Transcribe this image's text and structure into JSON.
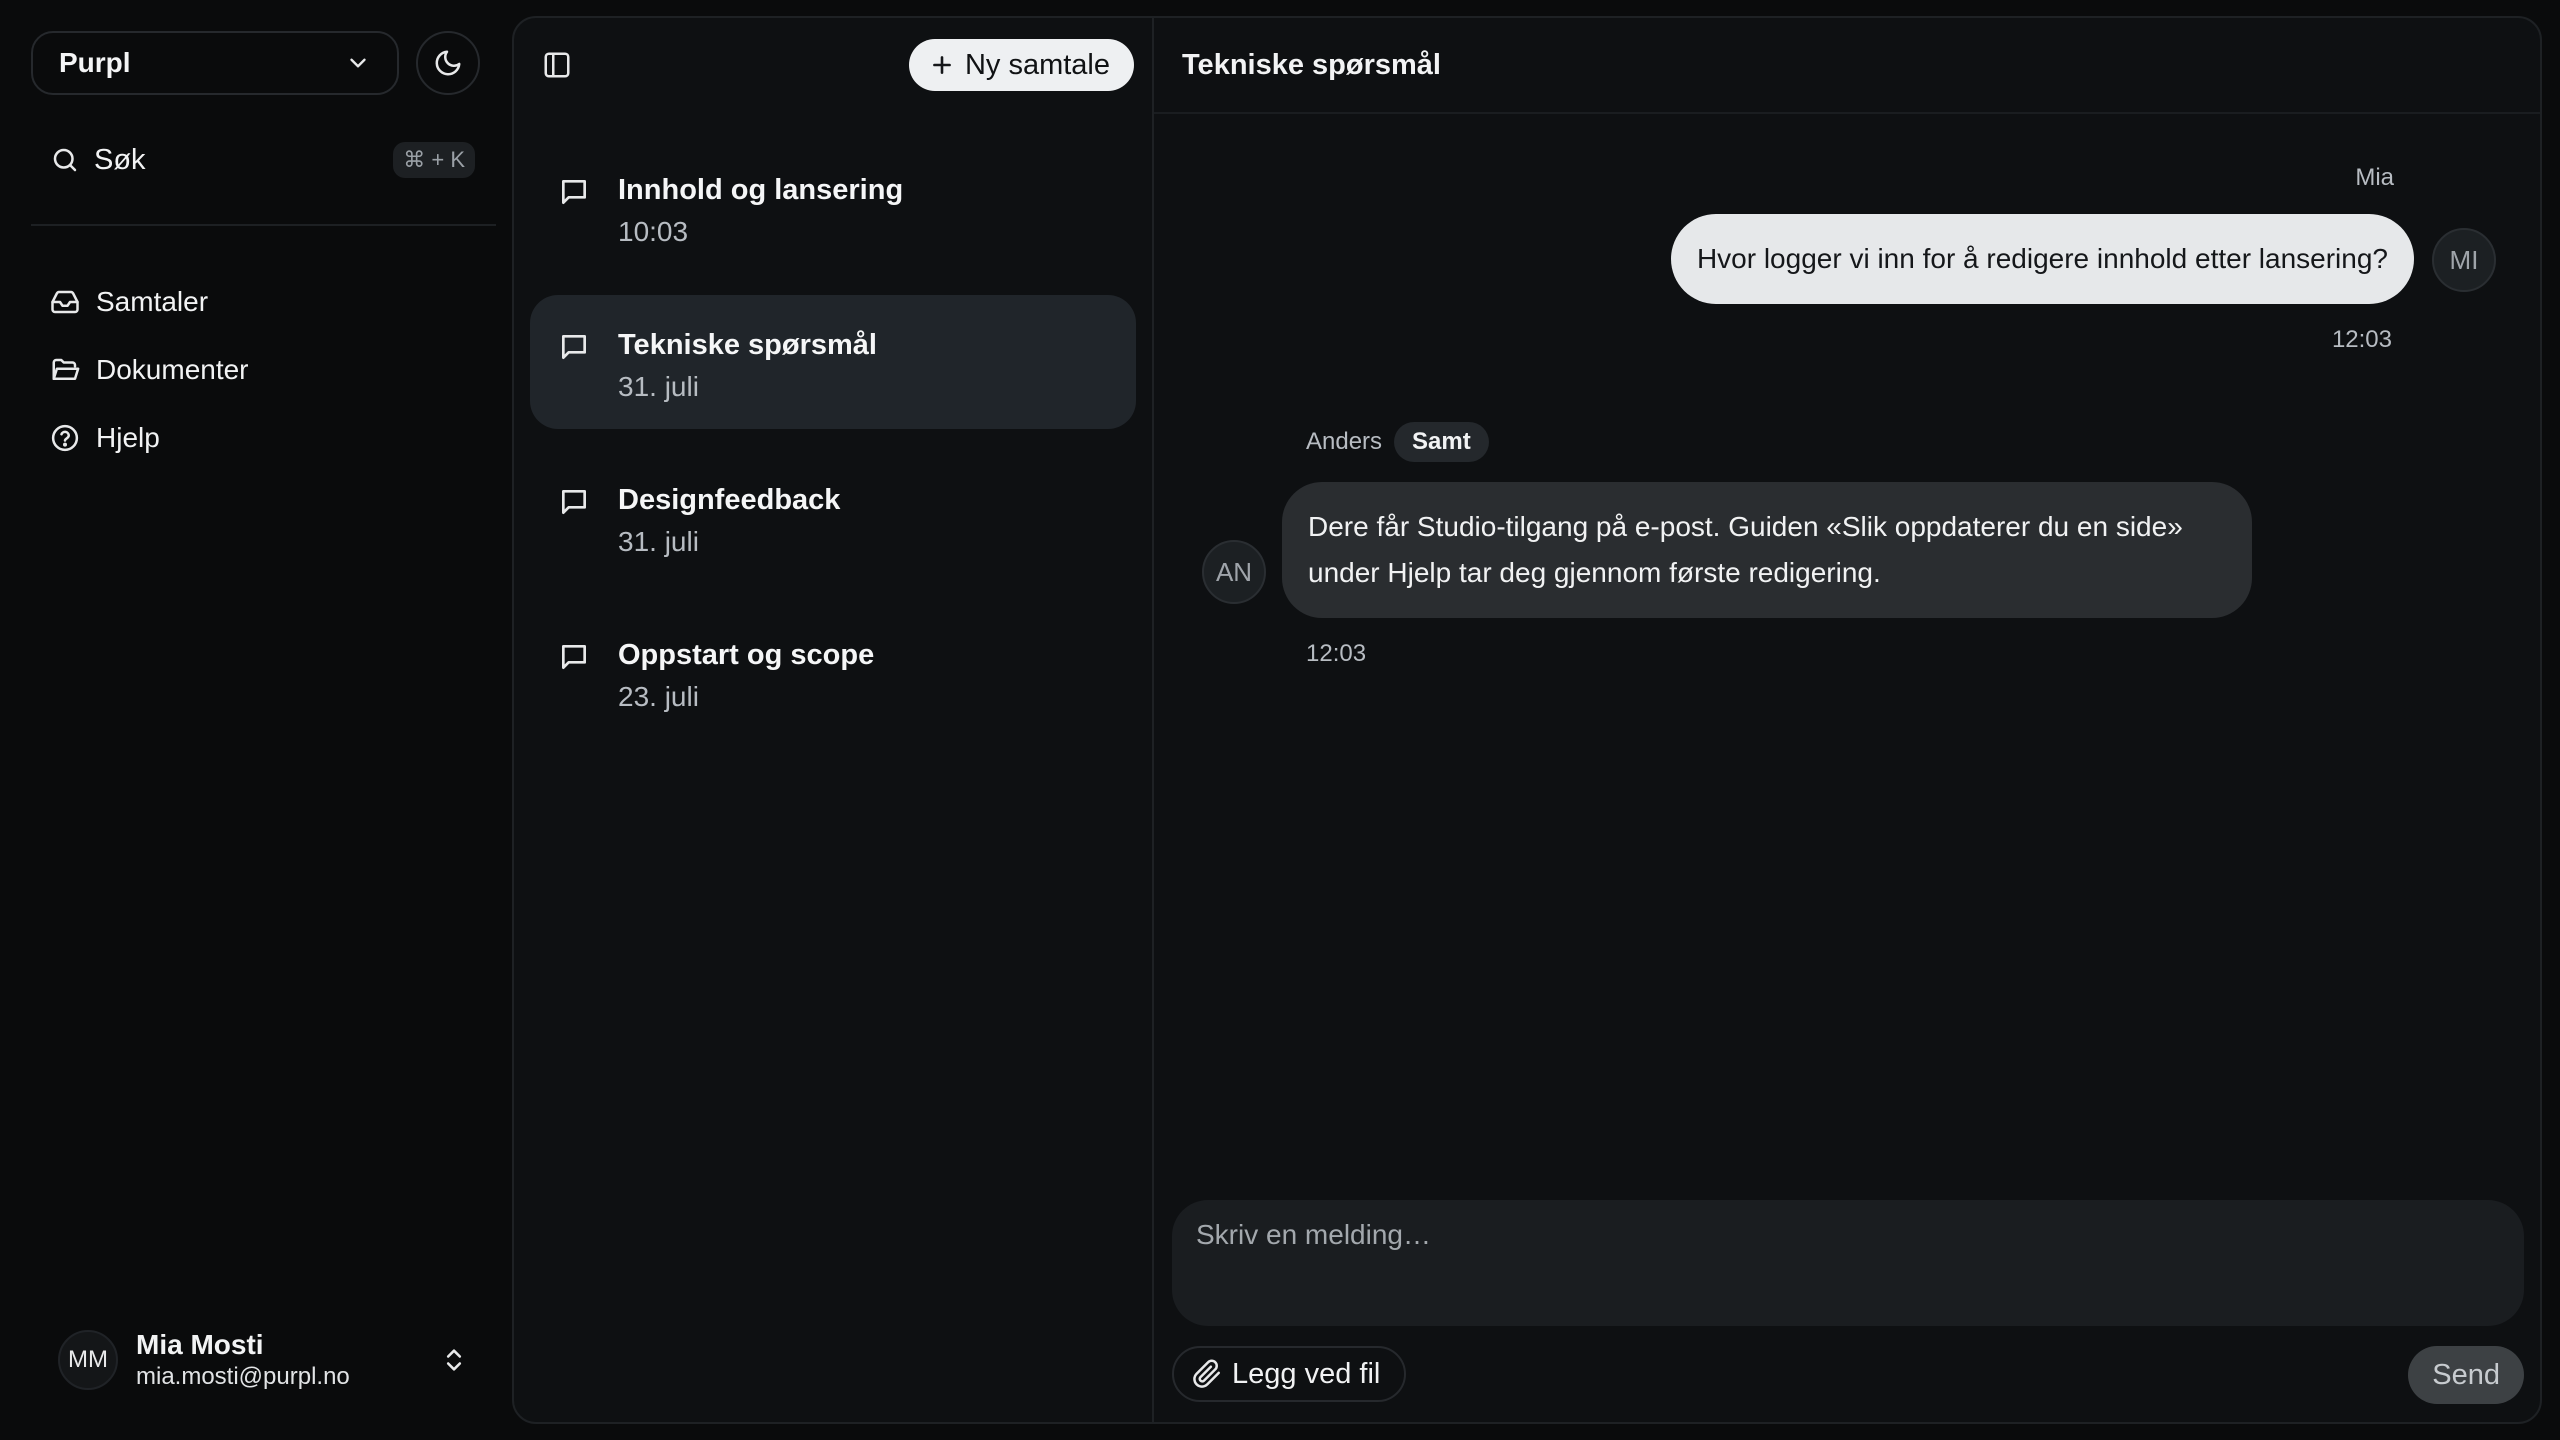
{
  "workspace": {
    "name": "Purpl"
  },
  "search": {
    "label": "Søk",
    "shortcut": "⌘ + K"
  },
  "nav": [
    {
      "label": "Samtaler",
      "icon": "inbox-icon"
    },
    {
      "label": "Dokumenter",
      "icon": "folder-icon"
    },
    {
      "label": "Hjelp",
      "icon": "help-circle-icon"
    }
  ],
  "user": {
    "initials": "MM",
    "name": "Mia Mosti",
    "email": "mia.mosti@purpl.no"
  },
  "conversations": {
    "new_label": "Ny samtale",
    "items": [
      {
        "title": "Innhold og lansering",
        "date": "10:03",
        "active": false
      },
      {
        "title": "Tekniske spørsmål",
        "date": "31. juli",
        "active": true
      },
      {
        "title": "Designfeedback",
        "date": "31. juli",
        "active": false
      },
      {
        "title": "Oppstart og scope",
        "date": "23. juli",
        "active": false
      }
    ]
  },
  "chat": {
    "title": "Tekniske spørsmål",
    "messages": [
      {
        "sender": "Mia",
        "initials": "MI",
        "text": "Hvor logger vi inn for å redigere innhold etter lansering?",
        "time": "12:03"
      },
      {
        "sender": "Anders",
        "badge": "Samt",
        "initials": "AN",
        "text": "Dere får Studio-tilgang på e-post. Guiden «Slik oppdaterer du en side» under Hjelp tar deg gjennom første redigering.",
        "time": "12:03"
      }
    ],
    "composer": {
      "placeholder": "Skriv en melding…",
      "attach_label": "Legg ved fil",
      "send_label": "Send"
    }
  },
  "colors": {
    "background": "#0a0b0c",
    "panel": "#0e1012",
    "active_item": "#20252a",
    "own_bubble": "#e6e8ea",
    "other_bubble": "#2a2d30"
  }
}
